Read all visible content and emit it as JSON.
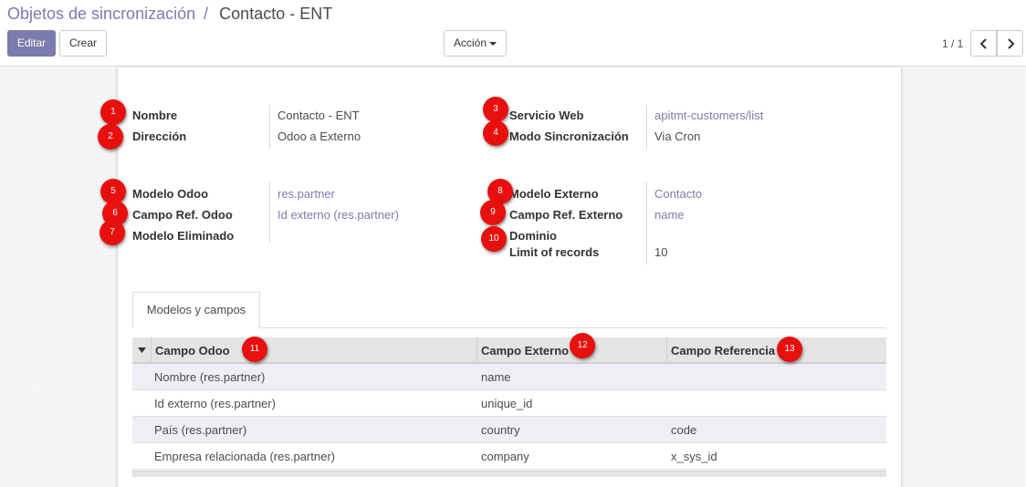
{
  "breadcrumb": {
    "parent": "Objetos de sincronización",
    "separator": "/",
    "current": "Contacto - ENT"
  },
  "toolbar": {
    "edit_label": "Editar",
    "create_label": "Crear",
    "action_label": "Acción"
  },
  "pager": {
    "value": "1 / 1"
  },
  "form": {
    "nombre": {
      "label": "Nombre",
      "value": "Contacto - ENT"
    },
    "direccion": {
      "label": "Dirección",
      "value": "Odoo a Externo"
    },
    "servicio_web": {
      "label": "Servicio Web",
      "value": "apitmt-customers/list"
    },
    "modo_sincronizacion": {
      "label": "Modo Sincronización",
      "value": "Via Cron"
    },
    "modelo_odoo": {
      "label": "Modelo Odoo",
      "value": "res.partner"
    },
    "campo_ref_odoo": {
      "label": "Campo Ref. Odoo",
      "value": "Id externo (res.partner)"
    },
    "modelo_eliminado": {
      "label": "Modelo Eliminado",
      "value": ""
    },
    "modelo_externo": {
      "label": "Modelo Externo",
      "value": "Contacto"
    },
    "campo_ref_externo": {
      "label": "Campo Ref. Externo",
      "value": "name"
    },
    "dominio": {
      "label": "Dominio",
      "value": ""
    },
    "limit_of_records": {
      "label": "Limit of records",
      "value": "10"
    }
  },
  "tabs": [
    {
      "label": "Modelos y campos"
    }
  ],
  "table": {
    "headers": [
      "Campo Odoo",
      "Campo Externo",
      "Campo Referencia"
    ],
    "rows": [
      [
        "Nombre (res.partner)",
        "name",
        ""
      ],
      [
        "Id externo (res.partner)",
        "unique_id",
        ""
      ],
      [
        "País (res.partner)",
        "country",
        "code"
      ],
      [
        "Empresa relacionada (res.partner)",
        "company",
        "x_sys_id"
      ]
    ]
  },
  "markers": [
    "1",
    "2",
    "3",
    "4",
    "5",
    "6",
    "7",
    "8",
    "9",
    "10",
    "11",
    "12",
    "13"
  ],
  "colors": {
    "brand": "#7c7bad",
    "marker": "#e8100e"
  }
}
